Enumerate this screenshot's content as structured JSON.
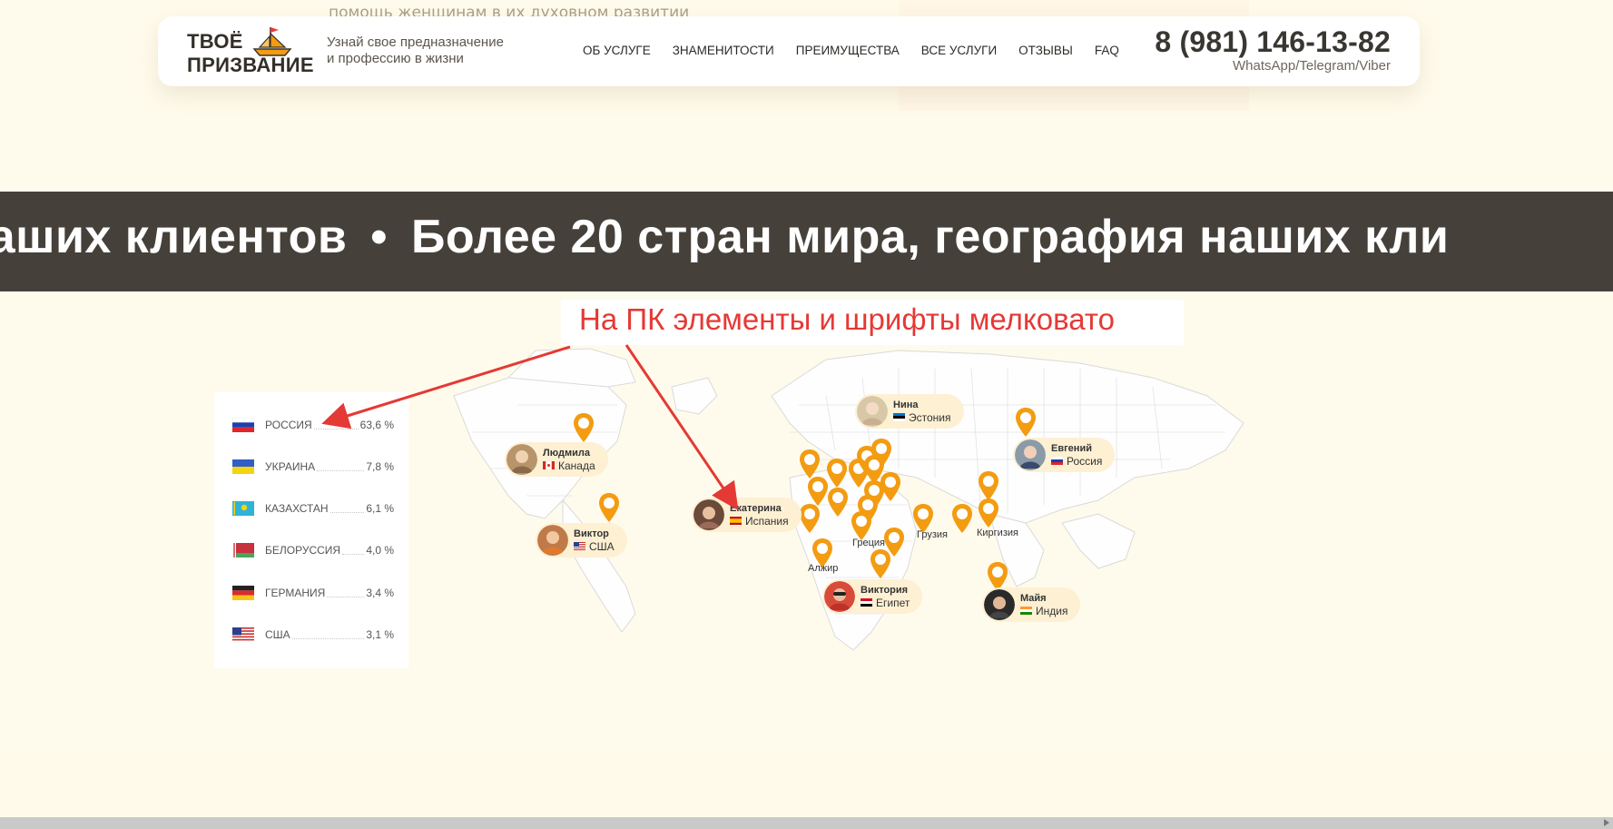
{
  "background": {
    "partial_text": "помощь женщинам в их духовном развитии"
  },
  "header": {
    "logo": {
      "line1": "ТВОЁ",
      "line2": "ПРИЗВАНИЕ",
      "icon": "boat-icon"
    },
    "tagline": {
      "line1": "Узнай свое предназначение",
      "line2": "и профессию в жизни"
    },
    "nav": [
      "ОБ УСЛУГЕ",
      "ЗНАМЕНИТОСТИ",
      "ПРЕИМУЩЕСТВА",
      "ВСЕ УСЛУГИ",
      "ОТЗЫВЫ",
      "FAQ"
    ],
    "phone": "8 (981) 146-13-82",
    "messengers": "WhatsApp/Telegram/Viber"
  },
  "ticker": {
    "lead": "я наших клиентов",
    "separator": "•",
    "main": "Более 20 стран мира, география наших кли"
  },
  "annotation": {
    "text": "На ПК элементы и шрифты мелковато",
    "color": "#e53935"
  },
  "stats": [
    {
      "flag": "russia-flag-icon",
      "country": "РОССИЯ",
      "value": "63,6 %"
    },
    {
      "flag": "ukraine-flag-icon",
      "country": "УКРАИНА",
      "value": "7,8 %"
    },
    {
      "flag": "kazakhstan-flag-icon",
      "country": "КАЗАХСТАН",
      "value": "6,1 %"
    },
    {
      "flag": "belarus-flag-icon",
      "country": "БЕЛОРУССИЯ",
      "value": "4,0 %"
    },
    {
      "flag": "germany-flag-icon",
      "country": "ГЕРМАНИЯ",
      "value": "3,4 %"
    },
    {
      "flag": "usa-flag-icon",
      "country": "США",
      "value": "3,1 %"
    }
  ],
  "clients": [
    {
      "name": "Людмила",
      "country": "Канада"
    },
    {
      "name": "Виктор",
      "country": "США"
    },
    {
      "name": "Екатерина",
      "country": "Испания"
    },
    {
      "name": "Нина",
      "country": "Эстония"
    },
    {
      "name": "Евгений",
      "country": "Россия"
    },
    {
      "name": "Виктория",
      "country": "Египет"
    },
    {
      "name": "Майя",
      "country": "Индия"
    }
  ],
  "map_labels": [
    "Греция",
    "Грузия",
    "Киргизия",
    "Алжир"
  ],
  "colors": {
    "pin": "#f39c12",
    "ticker_bg": "#45413a",
    "card_bg": "#fdf0d3",
    "page_bg": "#fffbec"
  }
}
